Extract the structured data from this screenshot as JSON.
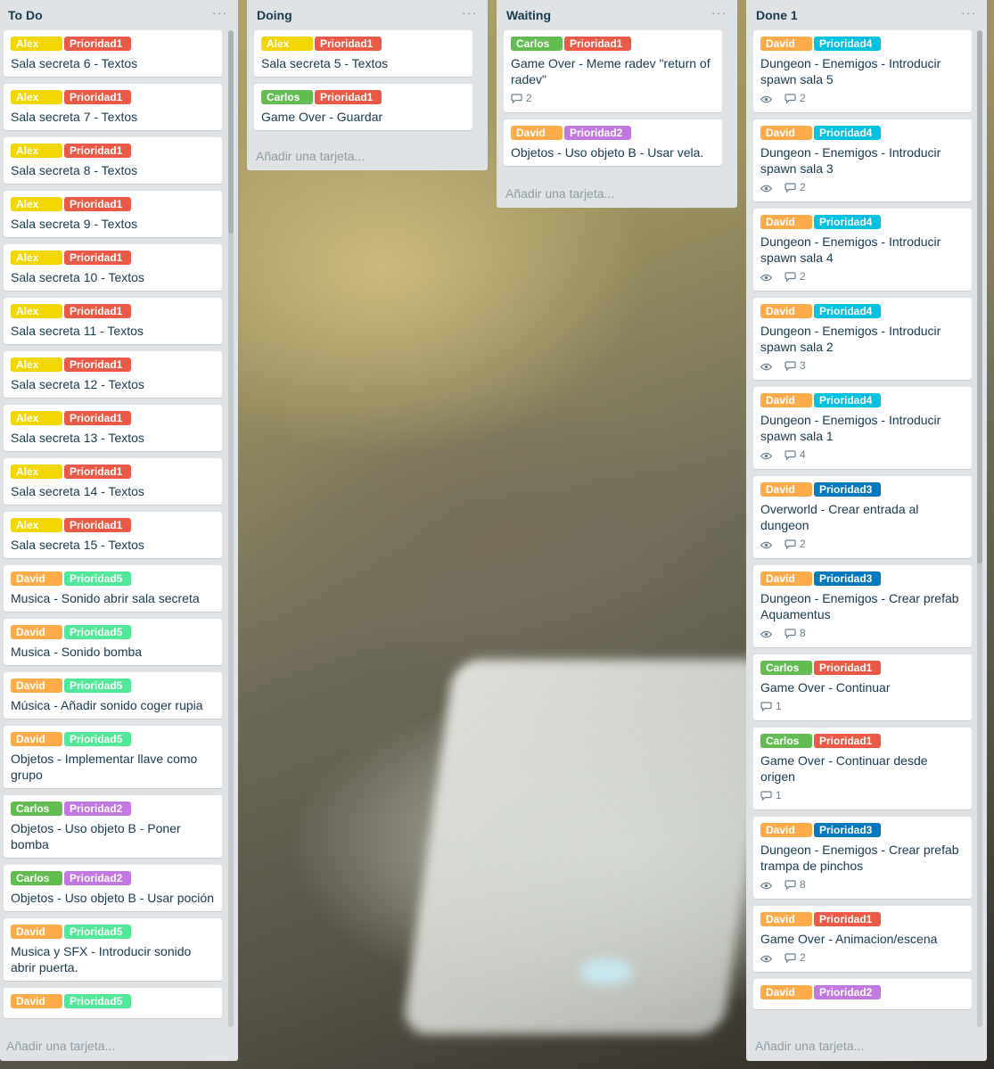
{
  "colors": {
    "Alex": "#f2d600",
    "Carlos": "#61bd4f",
    "David": "#ffab4a",
    "Prioridad1": "#eb5a46",
    "Prioridad2": "#c377e0",
    "Prioridad3": "#0079bf",
    "Prioridad4": "#00c2e0",
    "Prioridad5": "#51e898"
  },
  "icons": {
    "watch": "eye-icon",
    "comments": "comment-icon",
    "menu": "ellipsis-icon"
  },
  "lists": [
    {
      "title": "To Do",
      "add_card": "Añadir una tarjeta...",
      "cards": [
        {
          "labels": [
            "Alex",
            "Prioridad1"
          ],
          "title": "Sala secreta 6 - Textos"
        },
        {
          "labels": [
            "Alex",
            "Prioridad1"
          ],
          "title": "Sala secreta 7 - Textos"
        },
        {
          "labels": [
            "Alex",
            "Prioridad1"
          ],
          "title": "Sala secreta 8 - Textos"
        },
        {
          "labels": [
            "Alex",
            "Prioridad1"
          ],
          "title": "Sala secreta 9 - Textos"
        },
        {
          "labels": [
            "Alex",
            "Prioridad1"
          ],
          "title": "Sala secreta 10 - Textos"
        },
        {
          "labels": [
            "Alex",
            "Prioridad1"
          ],
          "title": "Sala secreta 11 - Textos"
        },
        {
          "labels": [
            "Alex",
            "Prioridad1"
          ],
          "title": "Sala secreta 12 - Textos"
        },
        {
          "labels": [
            "Alex",
            "Prioridad1"
          ],
          "title": "Sala secreta 13 - Textos"
        },
        {
          "labels": [
            "Alex",
            "Prioridad1"
          ],
          "title": "Sala secreta 14 - Textos"
        },
        {
          "labels": [
            "Alex",
            "Prioridad1"
          ],
          "title": "Sala secreta 15 - Textos"
        },
        {
          "labels": [
            "David",
            "Prioridad5"
          ],
          "title": "Musica - Sonido abrir sala secreta"
        },
        {
          "labels": [
            "David",
            "Prioridad5"
          ],
          "title": "Musica - Sonido bomba"
        },
        {
          "labels": [
            "David",
            "Prioridad5"
          ],
          "title": "Música - Añadir sonido coger rupia"
        },
        {
          "labels": [
            "David",
            "Prioridad5"
          ],
          "title": "Objetos - Implementar llave como grupo"
        },
        {
          "labels": [
            "Carlos",
            "Prioridad2"
          ],
          "title": "Objetos - Uso objeto B - Poner bomba"
        },
        {
          "labels": [
            "Carlos",
            "Prioridad2"
          ],
          "title": "Objetos - Uso objeto B - Usar poción"
        },
        {
          "labels": [
            "David",
            "Prioridad5"
          ],
          "title": "Musica y SFX - Introducir sonido abrir puerta."
        },
        {
          "labels": [
            "David",
            "Prioridad5"
          ],
          "title": ""
        }
      ]
    },
    {
      "title": "Doing",
      "add_card": "Añadir una tarjeta...",
      "cards": [
        {
          "labels": [
            "Alex",
            "Prioridad1"
          ],
          "title": "Sala secreta 5 - Textos"
        },
        {
          "labels": [
            "Carlos",
            "Prioridad1"
          ],
          "title": "Game Over - Guardar"
        }
      ]
    },
    {
      "title": "Waiting",
      "add_card": "Añadir una tarjeta...",
      "cards": [
        {
          "labels": [
            "Carlos",
            "Prioridad1"
          ],
          "title": "Game Over - Meme radev \"return of radev\"",
          "comments": "2"
        },
        {
          "labels": [
            "David",
            "Prioridad2"
          ],
          "title": "Objetos - Uso objeto B - Usar vela."
        }
      ]
    },
    {
      "title": "Done 1",
      "add_card": "Añadir una tarjeta...",
      "cards": [
        {
          "labels": [
            "David",
            "Prioridad4"
          ],
          "title": "Dungeon - Enemigos - Introducir spawn sala 5",
          "watch": true,
          "comments": "2"
        },
        {
          "labels": [
            "David",
            "Prioridad4"
          ],
          "title": "Dungeon - Enemigos - Introducir spawn sala 3",
          "watch": true,
          "comments": "2"
        },
        {
          "labels": [
            "David",
            "Prioridad4"
          ],
          "title": "Dungeon - Enemigos - Introducir spawn sala 4",
          "watch": true,
          "comments": "2"
        },
        {
          "labels": [
            "David",
            "Prioridad4"
          ],
          "title": "Dungeon - Enemigos - Introducir spawn sala 2",
          "watch": true,
          "comments": "3"
        },
        {
          "labels": [
            "David",
            "Prioridad4"
          ],
          "title": "Dungeon - Enemigos - Introducir spawn sala 1",
          "watch": true,
          "comments": "4"
        },
        {
          "labels": [
            "David",
            "Prioridad3"
          ],
          "title": "Overworld - Crear entrada al dungeon",
          "watch": true,
          "comments": "2"
        },
        {
          "labels": [
            "David",
            "Prioridad3"
          ],
          "title": "Dungeon - Enemigos - Crear prefab Aquamentus",
          "watch": true,
          "comments": "8"
        },
        {
          "labels": [
            "Carlos",
            "Prioridad1"
          ],
          "title": "Game Over - Continuar",
          "comments": "1"
        },
        {
          "labels": [
            "Carlos",
            "Prioridad1"
          ],
          "title": "Game Over - Continuar desde origen",
          "comments": "1"
        },
        {
          "labels": [
            "David",
            "Prioridad3"
          ],
          "title": "Dungeon - Enemigos - Crear prefab trampa de pinchos",
          "watch": true,
          "comments": "8"
        },
        {
          "labels": [
            "David",
            "Prioridad1"
          ],
          "title": "Game Over - Animacion/escena",
          "watch": true,
          "comments": "2"
        },
        {
          "labels": [
            "David",
            "Prioridad2"
          ],
          "title": ""
        }
      ]
    }
  ]
}
